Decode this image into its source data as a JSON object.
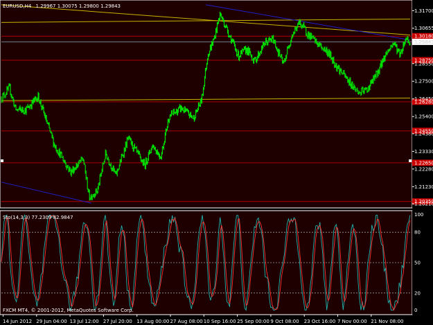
{
  "main_header": {
    "symbol_tf": "EURUSD,H4",
    "ohlc": "1.29967 1.30075 1.29800 1.29843"
  },
  "price_axis": {
    "labels": [
      "1.31700",
      "1.30655",
      "1.29843",
      "1.28550",
      "1.27500",
      "1.26450",
      "1.25400",
      "1.24380",
      "1.23330",
      "1.22280",
      "1.21230",
      "1.20210"
    ],
    "values": [
      1.317,
      1.30655,
      1.29843,
      1.2855,
      1.275,
      1.2645,
      1.254,
      1.2438,
      1.2333,
      1.2228,
      1.2123,
      1.2021
    ]
  },
  "price_tags": [
    {
      "value": 1.3018,
      "text": "1.30180",
      "color": "#cc0000"
    },
    {
      "value": 1.29843,
      "text": "1.29843",
      "color": "#ffffff"
    },
    {
      "value": 1.2875,
      "text": "1.28750",
      "color": "#cc0000"
    },
    {
      "value": 1.2628,
      "text": "1.26280",
      "color": "#cc0000"
    },
    {
      "value": 1.2455,
      "text": "1.24550",
      "color": "#cc0000"
    },
    {
      "value": 1.2265,
      "text": "1.22650",
      "color": "#cc0000"
    },
    {
      "value": 1.2035,
      "text": "1.20350",
      "color": "#cc0000"
    }
  ],
  "h_lines": [
    {
      "value": 1.3018,
      "color": "#b00000"
    },
    {
      "value": 1.2875,
      "color": "#b00000"
    },
    {
      "value": 1.2628,
      "color": "#b00000"
    },
    {
      "value": 1.2455,
      "color": "#b00000"
    },
    {
      "value": 1.2265,
      "color": "#b00000"
    },
    {
      "value": 1.2035,
      "color": "#b00000"
    },
    {
      "value": 1.29843,
      "color": "#708090"
    }
  ],
  "trend_lines": [
    {
      "from": [
        0,
        1.3205
      ],
      "to": [
        1,
        1.3025
      ],
      "color": "#c8b400"
    },
    {
      "from": [
        0,
        1.31
      ],
      "to": [
        1,
        1.312
      ],
      "color": "#c8b400"
    },
    {
      "from": [
        0,
        1.2635
      ],
      "to": [
        1,
        1.265
      ],
      "color": "#c8b400"
    },
    {
      "from": [
        0.5,
        1.3205
      ],
      "to": [
        1,
        1.2995
      ],
      "color": "#2020cc"
    },
    {
      "from": [
        0,
        1.215
      ],
      "to": [
        0.22,
        1.2025
      ],
      "color": "#2020cc"
    }
  ],
  "price_path": {
    "anchors": [
      [
        0,
        1.265
      ],
      [
        0.02,
        1.271
      ],
      [
        0.035,
        1.258
      ],
      [
        0.06,
        1.258
      ],
      [
        0.09,
        1.266
      ],
      [
        0.13,
        1.237
      ],
      [
        0.17,
        1.221
      ],
      [
        0.2,
        1.229
      ],
      [
        0.215,
        1.206
      ],
      [
        0.235,
        1.21
      ],
      [
        0.255,
        1.232
      ],
      [
        0.28,
        1.219
      ],
      [
        0.31,
        1.241
      ],
      [
        0.33,
        1.233
      ],
      [
        0.35,
        1.225
      ],
      [
        0.37,
        1.237
      ],
      [
        0.39,
        1.23
      ],
      [
        0.41,
        1.254
      ],
      [
        0.44,
        1.259
      ],
      [
        0.47,
        1.253
      ],
      [
        0.49,
        1.264
      ],
      [
        0.505,
        1.291
      ],
      [
        0.52,
        1.3
      ],
      [
        0.535,
        1.315
      ],
      [
        0.55,
        1.307
      ],
      [
        0.58,
        1.29
      ],
      [
        0.6,
        1.294
      ],
      [
        0.62,
        1.287
      ],
      [
        0.645,
        1.298
      ],
      [
        0.665,
        1.3
      ],
      [
        0.69,
        1.285
      ],
      [
        0.71,
        1.302
      ],
      [
        0.73,
        1.31
      ],
      [
        0.75,
        1.303
      ],
      [
        0.775,
        1.297
      ],
      [
        0.8,
        1.292
      ],
      [
        0.82,
        1.284
      ],
      [
        0.85,
        1.275
      ],
      [
        0.875,
        1.268
      ],
      [
        0.895,
        1.27
      ],
      [
        0.92,
        1.28
      ],
      [
        0.94,
        1.291
      ],
      [
        0.96,
        1.298
      ],
      [
        0.975,
        1.291
      ],
      [
        0.99,
        1.301
      ],
      [
        1,
        1.2984
      ]
    ],
    "color": "#00dd00"
  },
  "indicator": {
    "label": "Sto(14,3,3) 77.2309 82.9847",
    "levels": [
      80,
      50,
      20
    ],
    "level_labels": [
      "100",
      "80",
      "50",
      "20",
      "0"
    ],
    "main_color": "#20b2aa",
    "signal_color": "#ff3030"
  },
  "time_axis": {
    "labels": [
      "14 Jun 2012",
      "29 Jun 04:00",
      "13 Jul 12:00",
      "27 Jul 20:00",
      "13 Aug 00:00",
      "27 Aug 08:00",
      "10 Sep 16:00",
      "25 Sep 00:00",
      "9 Oct 08:00",
      "23 Oct 16:00",
      "7 Nov 00:00",
      "21 Nov 08:00"
    ]
  },
  "copyright": "FXCM MT4, © 2001-2012, MetaQuotes Software Corp."
}
